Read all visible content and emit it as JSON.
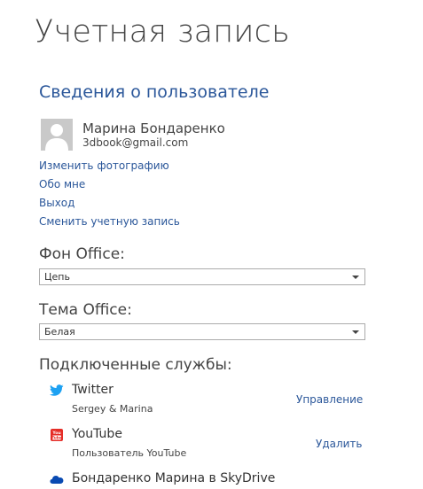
{
  "page": {
    "title": "Учетная запись"
  },
  "user_info": {
    "section_title": "Сведения о пользователе",
    "name": "Марина Бондаренко",
    "email": "3dbook@gmail.com",
    "links": {
      "change_photo": "Изменить фотографию",
      "about_me": "Обо мне",
      "sign_out": "Выход",
      "switch_account": "Сменить учетную запись"
    }
  },
  "office_background": {
    "label": "Фон Office:",
    "selected": "Цепь"
  },
  "office_theme": {
    "label": "Тема Office:",
    "selected": "Белая"
  },
  "connected_services": {
    "label": "Подключенные службы:",
    "items": [
      {
        "name": "Twitter",
        "sub": "Sergey & Marina",
        "action": "Управление",
        "icon": "twitter-icon",
        "color": "#1da1f2"
      },
      {
        "name": "YouTube",
        "sub": "Пользователь YouTube",
        "action": "Удалить",
        "icon": "youtube-icon",
        "color": "#e52d27"
      },
      {
        "name": "Бондаренко Марина в SkyDrive",
        "icon": "skydrive-icon",
        "color": "#094ab2"
      }
    ]
  },
  "colors": {
    "accent": "#2b579a",
    "text": "#444444"
  }
}
